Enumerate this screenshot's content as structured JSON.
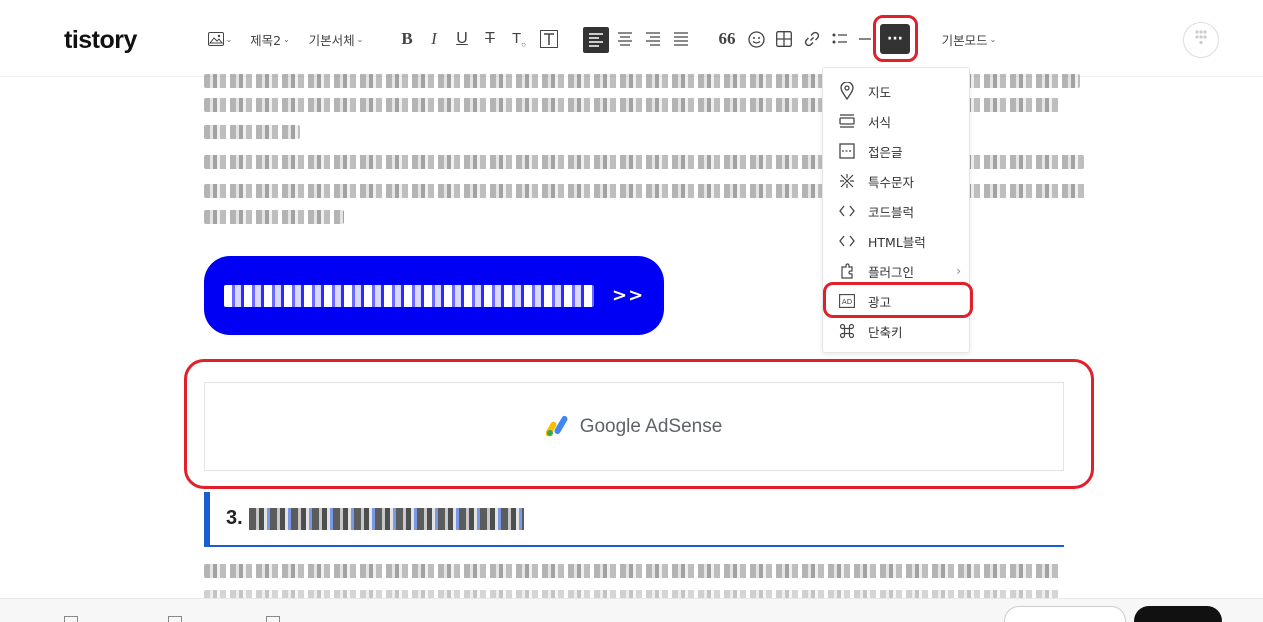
{
  "app": {
    "logo": "tistory"
  },
  "toolbar": {
    "heading_select": "제목2",
    "font_select": "기본서체",
    "more_label": "···",
    "mode_select": "기본모드"
  },
  "more_menu": {
    "items": [
      {
        "label": "지도",
        "icon": "map-pin-icon"
      },
      {
        "label": "서식",
        "icon": "template-icon"
      },
      {
        "label": "접은글",
        "icon": "fold-icon"
      },
      {
        "label": "특수문자",
        "icon": "special-char-icon"
      },
      {
        "label": "코드블럭",
        "icon": "code-icon"
      },
      {
        "label": "HTML블럭",
        "icon": "html-icon"
      },
      {
        "label": "플러그인",
        "icon": "plugin-icon"
      },
      {
        "label": "광고",
        "icon": "ad-icon"
      },
      {
        "label": "단축키",
        "icon": "command-icon"
      }
    ]
  },
  "content": {
    "cta_arrows": ">>",
    "ad_placeholder": "Google AdSense",
    "section_heading_prefix": "3."
  },
  "colors": {
    "accent_red": "#e0202a",
    "cta_blue": "#0000f5",
    "heading_blue": "#1a5ed3"
  }
}
